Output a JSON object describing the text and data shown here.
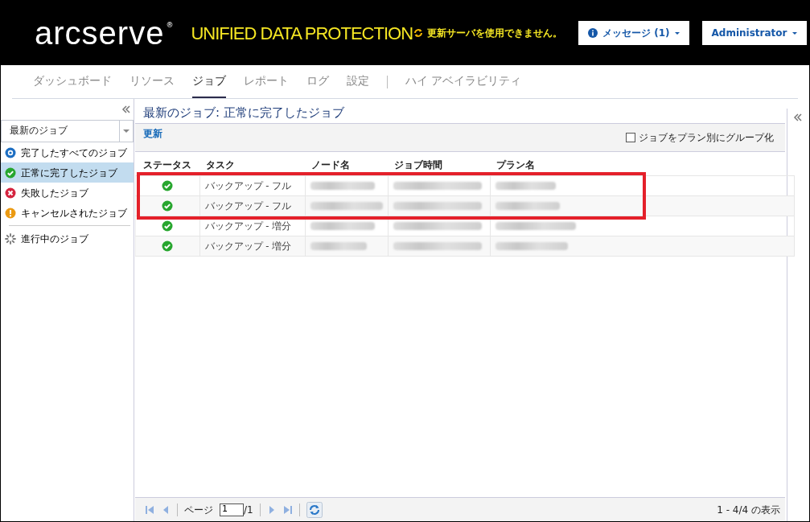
{
  "header": {
    "logo": "arcserve",
    "registered_mark": "®",
    "product": "UNIFIED DATA PROTECTION",
    "warning": "更新サーバを使用できません。",
    "messages_button": "メッセージ (1)",
    "user_button": "Administrator"
  },
  "nav_tabs": [
    {
      "label": "ダッシュボード",
      "selected": false,
      "group_start": false
    },
    {
      "label": "リソース",
      "selected": false,
      "group_start": false
    },
    {
      "label": "ジョブ",
      "selected": true,
      "group_start": false
    },
    {
      "label": "レポート",
      "selected": false,
      "group_start": false
    },
    {
      "label": "ログ",
      "selected": false,
      "group_start": false
    },
    {
      "label": "設定",
      "selected": false,
      "group_start": false
    },
    {
      "label": "ハイ アベイラビリティ",
      "selected": false,
      "group_start": true
    }
  ],
  "sidebar": {
    "dropdown": "最新のジョブ",
    "items": [
      {
        "label": "完了したすべてのジョブ",
        "kind": "all",
        "selected": false,
        "group_start": false
      },
      {
        "label": "正常に完了したジョブ",
        "kind": "success",
        "selected": true,
        "group_start": false
      },
      {
        "label": "失敗したジョブ",
        "kind": "failed",
        "selected": false,
        "group_start": false
      },
      {
        "label": "キャンセルされたジョブ",
        "kind": "canceled",
        "selected": false,
        "group_start": false
      },
      {
        "label": "進行中のジョブ",
        "kind": "running",
        "selected": false,
        "group_start": true
      }
    ]
  },
  "main": {
    "title": "最新のジョブ: 正常に完了したジョブ",
    "refresh_link": "更新",
    "group_checkbox": {
      "label": "ジョブをプラン別にグループ化",
      "checked": false
    },
    "table": {
      "columns": [
        "ステータス",
        "タスク",
        "ノード名",
        "ジョブ時間",
        "プラン名"
      ],
      "rows": [
        {
          "kind": "success",
          "task": "バックアップ - フル",
          "highlighted": true
        },
        {
          "kind": "success",
          "task": "バックアップ - フル",
          "highlighted": true
        },
        {
          "kind": "success",
          "task": "バックアップ - 増分",
          "highlighted": false
        },
        {
          "kind": "success",
          "task": "バックアップ - 増分",
          "highlighted": false
        }
      ]
    },
    "pager": {
      "page_label": "ページ",
      "page_value": "1",
      "page_total": "/1",
      "summary": "1 - 4/4 の表示"
    }
  }
}
